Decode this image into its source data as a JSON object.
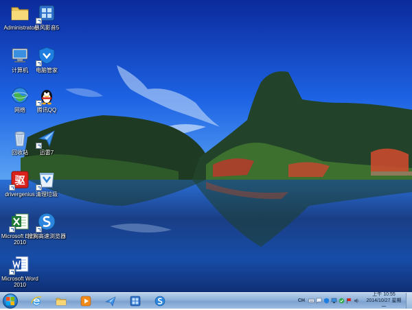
{
  "desktop": {
    "icons": [
      {
        "label": "Administrator",
        "icon": "folder-icon"
      },
      {
        "label": "暴风影音5",
        "icon": "storm-player-icon"
      },
      {
        "label": "计算机",
        "icon": "computer-icon"
      },
      {
        "label": "电脑管家",
        "icon": "pc-manager-icon"
      },
      {
        "label": "网络",
        "icon": "network-icon"
      },
      {
        "label": "腾讯QQ",
        "icon": "qq-icon"
      },
      {
        "label": "回收站",
        "icon": "recycle-bin-icon"
      },
      {
        "label": "迅雷7",
        "icon": "thunder-icon"
      },
      {
        "label": "drivergenius",
        "icon": "driver-genius-icon"
      },
      {
        "label": "清理垃圾",
        "icon": "cleanup-icon"
      },
      {
        "label": "Microsoft Excel 2010",
        "icon": "excel-icon"
      },
      {
        "label": "搜狗高速浏览器",
        "icon": "sogou-browser-icon"
      },
      {
        "label": "Microsoft Word 2010",
        "icon": "word-icon"
      }
    ]
  },
  "taskbar": {
    "start": {
      "icon": "windows-start-icon"
    },
    "pinned": [
      {
        "icon": "internet-explorer-icon"
      },
      {
        "icon": "file-explorer-icon"
      },
      {
        "icon": "media-player-icon"
      },
      {
        "icon": "thunder-icon"
      },
      {
        "icon": "storm-player-icon"
      },
      {
        "icon": "sogou-browser-icon"
      }
    ],
    "tray": {
      "ime": "CH",
      "icons": [
        "keyboard-icon",
        "action-center-icon",
        "shield-icon",
        "network-icon",
        "security-icon",
        "flag-icon",
        "volume-icon"
      ],
      "time": "上午 10:55",
      "date": "2014/10/27 星期一"
    }
  },
  "colors": {
    "sky_top": "#0d2fa3",
    "taskbar": "#8fb1d9",
    "accent": "#2c8ad8"
  }
}
